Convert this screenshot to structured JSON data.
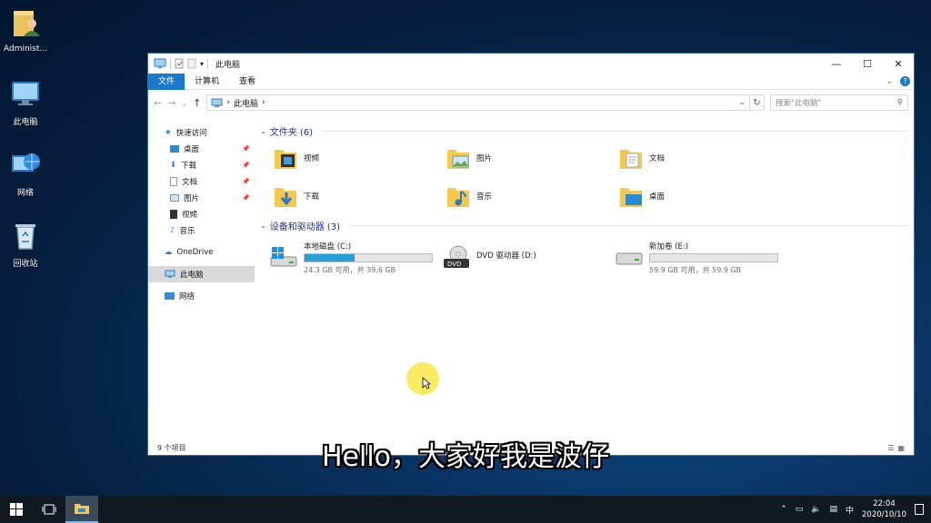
{
  "desktop": {
    "icons": [
      {
        "label": "Administ..."
      },
      {
        "label": "此电脑"
      },
      {
        "label": "网络"
      },
      {
        "label": "回收站"
      }
    ]
  },
  "window": {
    "title": "此电脑",
    "ribbon_tabs": [
      "文件",
      "计算机",
      "查看"
    ],
    "address_path": "此电脑",
    "search_placeholder": "搜索\"此电脑\"",
    "status_text": "9 个项目"
  },
  "nav_pane": {
    "quick_access": "快速访问",
    "quick_items": [
      "桌面",
      "下载",
      "文档",
      "图片",
      "视频",
      "音乐"
    ],
    "onedrive": "OneDrive",
    "this_pc": "此电脑",
    "network": "网络"
  },
  "folders_group": {
    "title": "文件夹 (6)",
    "items": [
      "视频",
      "图片",
      "文档",
      "下载",
      "音乐",
      "桌面"
    ]
  },
  "drives_group": {
    "title": "设备和驱动器 (3)",
    "drives": [
      {
        "name": "本地磁盘 (C:)",
        "free_text": "24.3 GB 可用，共 39.6 GB",
        "used_fraction": 0.39
      },
      {
        "name": "DVD 驱动器 (D:)"
      },
      {
        "name": "新加卷 (E:)",
        "free_text": "59.9 GB 可用，共 59.9 GB",
        "used_fraction": 0.0
      }
    ]
  },
  "caption": "Hello，大家好我是波仔",
  "taskbar": {
    "ime": "中",
    "time": "22:04",
    "date": "2020/10/10"
  },
  "colors": {
    "accent": "#1979ca",
    "drive_fill": "#26a0da",
    "folder_yellow": "#f6c94c"
  }
}
